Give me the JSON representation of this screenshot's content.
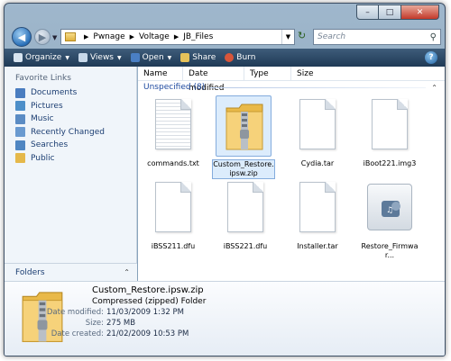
{
  "window": {
    "caption_buttons": {
      "minimize": "–",
      "maximize": "□",
      "close": "✕"
    }
  },
  "address_bar": {
    "breadcrumbs": [
      "Pwnage",
      "Voltage",
      "JB_Files"
    ],
    "separator": "▶",
    "search_placeholder": "Search"
  },
  "toolbar": {
    "items": [
      {
        "label": "Organize",
        "icon": "organize-icon",
        "dropdown": true
      },
      {
        "label": "Views",
        "icon": "views-icon",
        "dropdown": true
      },
      {
        "label": "Open",
        "icon": "open-icon",
        "dropdown": true
      },
      {
        "label": "Share",
        "icon": "share-icon",
        "dropdown": false
      },
      {
        "label": "Burn",
        "icon": "burn-icon",
        "dropdown": false
      }
    ]
  },
  "nav_pane": {
    "heading": "Favorite Links",
    "links": [
      {
        "label": "Documents",
        "icon": "documents-icon",
        "color": "#4a7dc0"
      },
      {
        "label": "Pictures",
        "icon": "pictures-icon",
        "color": "#4d8fc9"
      },
      {
        "label": "Music",
        "icon": "music-icon",
        "color": "#5b8cc4"
      },
      {
        "label": "Recently Changed",
        "icon": "recent-icon",
        "color": "#6a9ad0"
      },
      {
        "label": "Searches",
        "icon": "searches-icon",
        "color": "#4f86c2"
      },
      {
        "label": "Public",
        "icon": "public-folder-icon",
        "color": "#e5b84a"
      }
    ],
    "folders_label": "Folders"
  },
  "columns": [
    "Name",
    "Date modified",
    "Type",
    "Size"
  ],
  "group": {
    "label": "Unspecified (8)"
  },
  "files": [
    {
      "name": "commands.txt",
      "kind": "text"
    },
    {
      "name": "Custom_Restore.ipsw.zip",
      "kind": "zip",
      "selected": true
    },
    {
      "name": "Cydia.tar",
      "kind": "blank"
    },
    {
      "name": "iBoot221.img3",
      "kind": "blank"
    },
    {
      "name": "iBSS211.dfu",
      "kind": "blank"
    },
    {
      "name": "iBSS221.dfu",
      "kind": "blank"
    },
    {
      "name": "Installer.tar",
      "kind": "blank"
    },
    {
      "name": "Restore_Firmwar...",
      "kind": "app"
    }
  ],
  "details": {
    "name": "Custom_Restore.ipsw.zip",
    "type": "Compressed (zipped) Folder",
    "rows": [
      {
        "key": "Date modified:",
        "value": "11/03/2009 1:32 PM"
      },
      {
        "key": "Size:",
        "value": "275 MB"
      },
      {
        "key": "Date created:",
        "value": "21/02/2009 10:53 PM"
      }
    ]
  },
  "colors": {
    "toolbar": "#2b4867",
    "link": "#1c3e72",
    "group": "#1e4aa0",
    "selection": "#dcecfc"
  }
}
